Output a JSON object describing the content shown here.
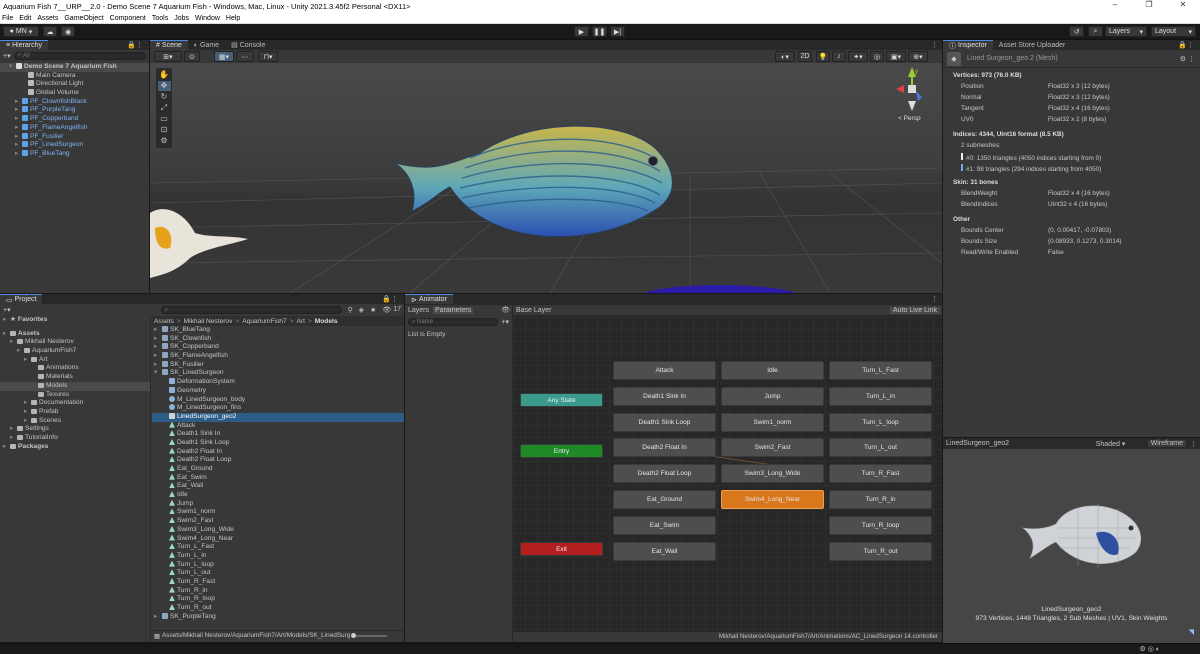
{
  "window": {
    "title": "Aquarium Fish 7__URP__2.0 - Demo Scene 7 Aquarium Fish - Windows, Mac, Linux - Unity 2021.3.45f2 Personal <DX11>"
  },
  "menu": [
    "File",
    "Edit",
    "Assets",
    "GameObject",
    "Component",
    "Tools",
    "Jobs",
    "Window",
    "Help"
  ],
  "toolbar": {
    "account": "MN",
    "layers": "Layers",
    "layout": "Layout"
  },
  "hierarchy": {
    "tab": "Hierarchy",
    "search_placeholder": "All",
    "items": [
      {
        "label": "Demo Scene 7 Aquarium Fish",
        "depth": 0,
        "type": "scene"
      },
      {
        "label": "Main Camera",
        "depth": 2,
        "type": "go"
      },
      {
        "label": "Directional Light",
        "depth": 2,
        "type": "go"
      },
      {
        "label": "Global Volume",
        "depth": 2,
        "type": "go"
      },
      {
        "label": "PF_ClownfishBlack",
        "depth": 1,
        "type": "prefab"
      },
      {
        "label": "PF_PurpleTang",
        "depth": 1,
        "type": "prefab"
      },
      {
        "label": "PF_Copperband",
        "depth": 1,
        "type": "prefab"
      },
      {
        "label": "PF_FlameAngelfish",
        "depth": 1,
        "type": "prefab"
      },
      {
        "label": "PF_Fusilier",
        "depth": 1,
        "type": "prefab"
      },
      {
        "label": "PF_LinedSurgeon",
        "depth": 1,
        "type": "prefab"
      },
      {
        "label": "PF_BlueTang",
        "depth": 1,
        "type": "prefab"
      }
    ]
  },
  "scene": {
    "tabs": [
      "Scene",
      "Game",
      "Console"
    ],
    "persp": "< Persp",
    "mode2d": "2D",
    "axes": {
      "y": "y",
      "x": "x",
      "z": "z"
    }
  },
  "inspector": {
    "tabs": [
      "Inspector",
      "Asset Store Uploader"
    ],
    "title": "Lined Surgeon_geo 2 (Mesh)",
    "vertices_header": "Vertices: 973 (76.0 KB)",
    "vertex_attrs": [
      [
        "Position",
        "Float32 x 3 (12 bytes)"
      ],
      [
        "Normal",
        "Float32 x 3 (12 bytes)"
      ],
      [
        "Tangent",
        "Float32 x 4 (16 bytes)"
      ],
      [
        "UV0",
        "Float32 x 2 (8 bytes)"
      ]
    ],
    "indices_header": "Indices: 4344, UInt16 format (8.5 KB)",
    "submeshes_label": "2 submeshes:",
    "submeshes": [
      "#0: 1350 triangles (4050 indices starting from 0)",
      "#1: 98 triangles (294 indices starting from 4050)"
    ],
    "skin_header": "Skin: 31 bones",
    "skin_attrs": [
      [
        "BlendWeight",
        "Float32 x 4 (16 bytes)"
      ],
      [
        "BlendIndices",
        "UInt32 x 4 (16 bytes)"
      ]
    ],
    "other_header": "Other",
    "other_attrs": [
      [
        "Bounds Center",
        "(0, 0.00417, -0.07803)"
      ],
      [
        "Bounds Size",
        "(0.08933, 0.1273, 0.3014)"
      ],
      [
        "Read/Write Enabled",
        "False"
      ]
    ]
  },
  "preview": {
    "name": "LinedSurgeon_geo2",
    "shading": "Shaded",
    "wireframe": "Wireframe",
    "caption_name": "LinedSurgeon_geo2",
    "caption_stats": "973 Vertices, 1448 Triangles, 2 Sub Meshes | UV1, Skin Weights"
  },
  "project": {
    "tab": "Project",
    "count": "17",
    "tree": [
      {
        "label": "Favorites",
        "depth": 0,
        "star": true
      },
      {
        "label": "Assets",
        "depth": 0
      },
      {
        "label": "Mikhail Nesterov",
        "depth": 1
      },
      {
        "label": "AquariumFish7",
        "depth": 2
      },
      {
        "label": "Art",
        "depth": 3
      },
      {
        "label": "Animations",
        "depth": 4
      },
      {
        "label": "Materials",
        "depth": 4
      },
      {
        "label": "Models",
        "depth": 4,
        "selected": true
      },
      {
        "label": "Texures",
        "depth": 4
      },
      {
        "label": "Documentation",
        "depth": 3
      },
      {
        "label": "Prefab",
        "depth": 3
      },
      {
        "label": "Scenes",
        "depth": 3
      },
      {
        "label": "Settings",
        "depth": 1
      },
      {
        "label": "TutorialInfo",
        "depth": 1
      },
      {
        "label": "Packages",
        "depth": 0
      }
    ],
    "breadcrumb": [
      "Assets",
      "Mikhail Nesterov",
      "AquariumFish7",
      "Art",
      "Models"
    ],
    "files": [
      {
        "label": "SK_BlueTang",
        "depth": 0,
        "type": "model"
      },
      {
        "label": "SK_Clownfish",
        "depth": 0,
        "type": "model"
      },
      {
        "label": "SK_Copperband",
        "depth": 0,
        "type": "model"
      },
      {
        "label": "SK_FlameAngelfish",
        "depth": 0,
        "type": "model"
      },
      {
        "label": "SK_Fusilier",
        "depth": 0,
        "type": "model"
      },
      {
        "label": "SK_LinedSurgeon",
        "depth": 0,
        "type": "model"
      },
      {
        "label": "DeformationSystem",
        "depth": 1,
        "type": "go"
      },
      {
        "label": "Geometry",
        "depth": 1,
        "type": "go"
      },
      {
        "label": "M_LinedSurgeon_body",
        "depth": 1,
        "type": "mat"
      },
      {
        "label": "M_LinedSurgeon_fins",
        "depth": 1,
        "type": "mat"
      },
      {
        "label": "LinedSurgeon_geo2",
        "depth": 1,
        "type": "mesh",
        "selected": true
      },
      {
        "label": "Attack",
        "depth": 1,
        "type": "anim"
      },
      {
        "label": "Death1 Sink In",
        "depth": 1,
        "type": "anim"
      },
      {
        "label": "Death1 Sink Loop",
        "depth": 1,
        "type": "anim"
      },
      {
        "label": "Death2 Float In",
        "depth": 1,
        "type": "anim"
      },
      {
        "label": "Death2 Float Loop",
        "depth": 1,
        "type": "anim"
      },
      {
        "label": "Eat_Ground",
        "depth": 1,
        "type": "anim"
      },
      {
        "label": "Eat_Swim",
        "depth": 1,
        "type": "anim"
      },
      {
        "label": "Eat_Wall",
        "depth": 1,
        "type": "anim"
      },
      {
        "label": "Idle",
        "depth": 1,
        "type": "anim"
      },
      {
        "label": "Jump",
        "depth": 1,
        "type": "anim"
      },
      {
        "label": "Swim1_norm",
        "depth": 1,
        "type": "anim"
      },
      {
        "label": "Swim2_Fast",
        "depth": 1,
        "type": "anim"
      },
      {
        "label": "Swim3_Long_Wide",
        "depth": 1,
        "type": "anim"
      },
      {
        "label": "Swim4_Long_Near",
        "depth": 1,
        "type": "anim"
      },
      {
        "label": "Turn_L_Fast",
        "depth": 1,
        "type": "anim"
      },
      {
        "label": "Turn_L_in",
        "depth": 1,
        "type": "anim"
      },
      {
        "label": "Turn_L_loop",
        "depth": 1,
        "type": "anim"
      },
      {
        "label": "Turn_L_out",
        "depth": 1,
        "type": "anim"
      },
      {
        "label": "Turn_R_Fast",
        "depth": 1,
        "type": "anim"
      },
      {
        "label": "Turn_R_in",
        "depth": 1,
        "type": "anim"
      },
      {
        "label": "Turn_R_loop",
        "depth": 1,
        "type": "anim"
      },
      {
        "label": "Turn_R_out",
        "depth": 1,
        "type": "anim"
      },
      {
        "label": "SK_PurpleTang",
        "depth": 0,
        "type": "model"
      }
    ],
    "footer_path": "Assets/Mikhail Nesterov/AquariumFish7/Art/Models/SK_LinedSurg"
  },
  "animator": {
    "tab": "Animator",
    "subtabs": [
      "Layers",
      "Parameters"
    ],
    "base_layer": "Base Layer",
    "auto_live_link": "Auto Live Link",
    "name_placeholder": "Name",
    "list_empty": "List is Empty",
    "special_states": {
      "any": "Any State",
      "entry": "Entry",
      "exit": "Exit"
    },
    "states": [
      [
        "Attack",
        "Idle",
        "Turn_L_Fast"
      ],
      [
        "Death1 Sink In",
        "Jump",
        "Turn_L_in"
      ],
      [
        "Death1 Sink Loop",
        "Swim1_norm",
        "Turn_L_loop"
      ],
      [
        "Death2 Float In",
        "Swim2_Fast",
        "Turn_L_out"
      ],
      [
        "Death2 Float Loop",
        "Swim3_Long_Wide",
        "Turn_R_Fast"
      ],
      [
        "Eat_Ground",
        "Swim4_Long_Near",
        "Turn_R_in"
      ],
      [
        "Eat_Swim",
        "",
        "Turn_R_loop"
      ],
      [
        "Eat_Wall",
        "",
        "Turn_R_out"
      ]
    ],
    "default_state": "Swim4_Long_Near",
    "footer": "Mikhail Nesterov/AquariumFish7/Art/Animations/AC_LinedSurgeon 14.controller"
  },
  "colors": {
    "accent": "#2c5d87",
    "default_state": "#d9771c",
    "entry": "#1f8a25",
    "any_state": "#3a9b8a",
    "exit": "#b31e1e"
  }
}
